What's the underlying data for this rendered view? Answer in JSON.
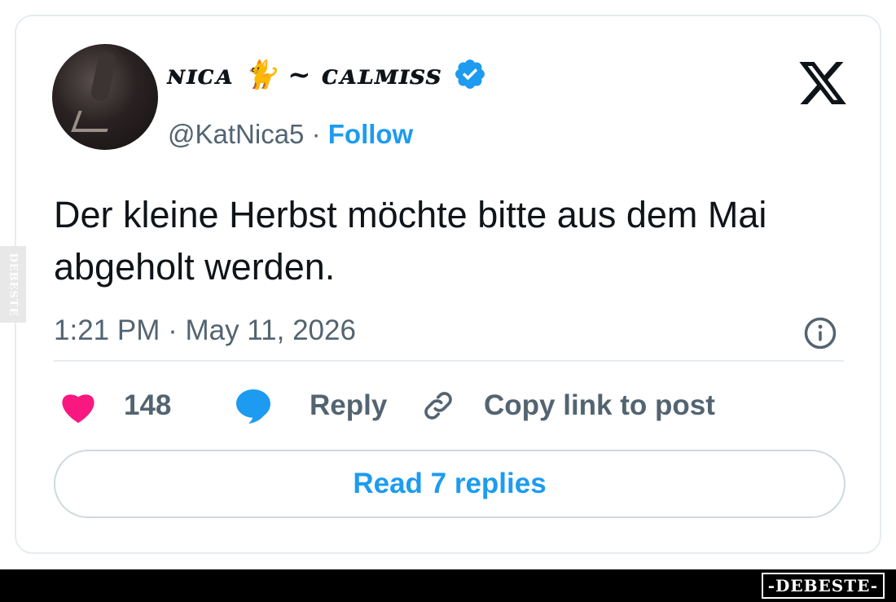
{
  "author": {
    "display_name": "ɴɪᴄᴀ 🐈 ~ ᴄᴀʟᴍɪss",
    "handle": "@KatNica5",
    "separator": "·",
    "follow_label": "Follow",
    "verified": true
  },
  "platform_icon": "x-logo-icon",
  "tweet": {
    "text": "Der kleine Herbst möchte bitte aus dem Mai abgeholt werden.",
    "timestamp": "1:21 PM · May 11, 2026"
  },
  "actions": {
    "like_count": "148",
    "reply_label": "Reply",
    "copy_label": "Copy link to post"
  },
  "read_replies_label": "Read 7 replies",
  "watermark": {
    "side_text": "DEBESTE",
    "bottom_text": "-DEBESTE-"
  },
  "colors": {
    "accent": "#1d9bf0",
    "like": "#f91880",
    "muted": "#536471"
  }
}
